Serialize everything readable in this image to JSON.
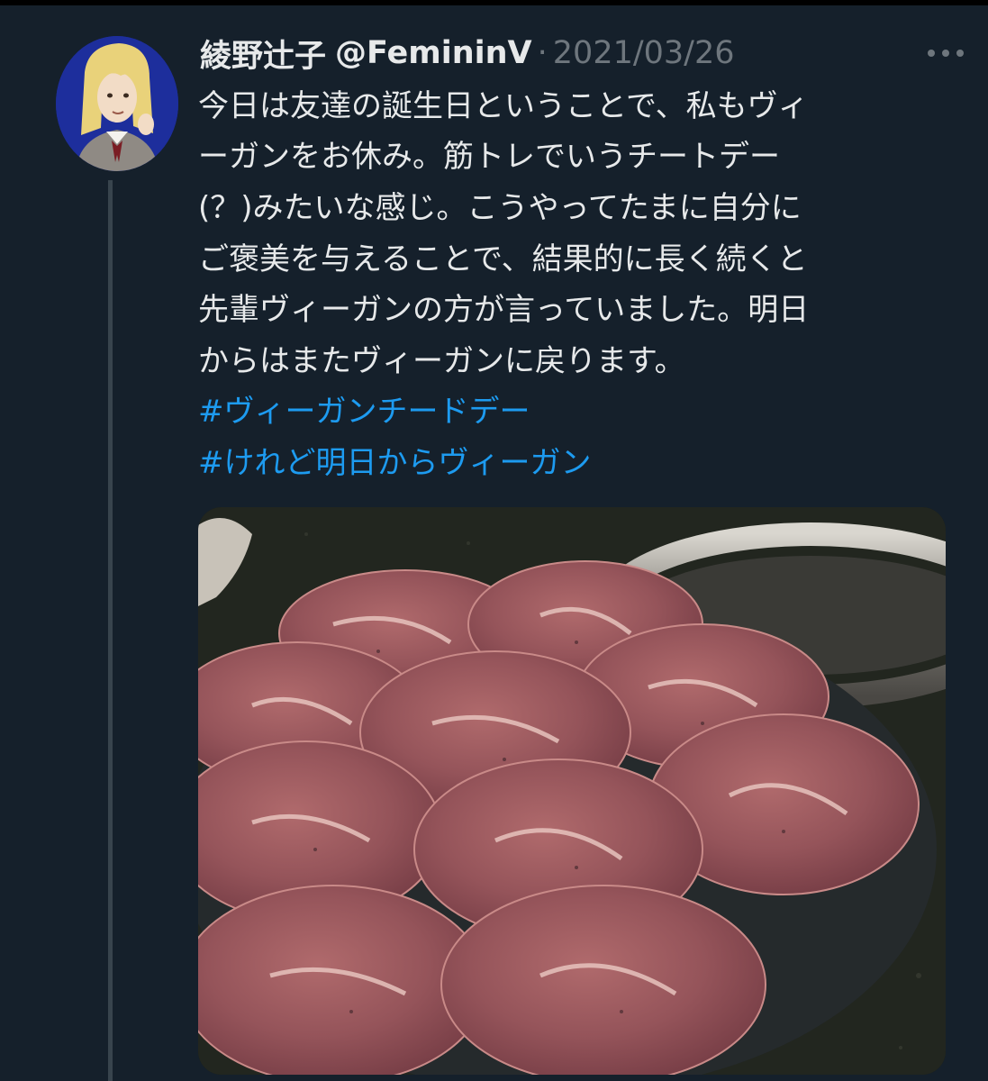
{
  "tweet": {
    "author_name": "綾野辻子",
    "handle": "@FemininV",
    "separator": "·",
    "date": "2021/03/26",
    "body_lines": [
      "今日は友達の誕生日ということで、私もヴィ",
      "ーガンをお休み。筋トレでいうチートデー",
      "(？)みたいな感じ。こうやってたまに自分に",
      "ご褒美を与えることで、結果的に長く続くと",
      "先輩ヴィーガンの方が言っていました。明日",
      "からはまたヴィーガンに戻ります。"
    ],
    "hashtags": [
      "#ヴィーガンチードデー",
      "#けれど明日からヴィーガン"
    ]
  },
  "icons": {
    "more": "more-horizontal-icon"
  },
  "colors": {
    "background": "#15202b",
    "text": "#e7e9ea",
    "muted": "#6e767d",
    "hashtag": "#1d9bf0",
    "avatar_bg": "#1d2e9c"
  }
}
